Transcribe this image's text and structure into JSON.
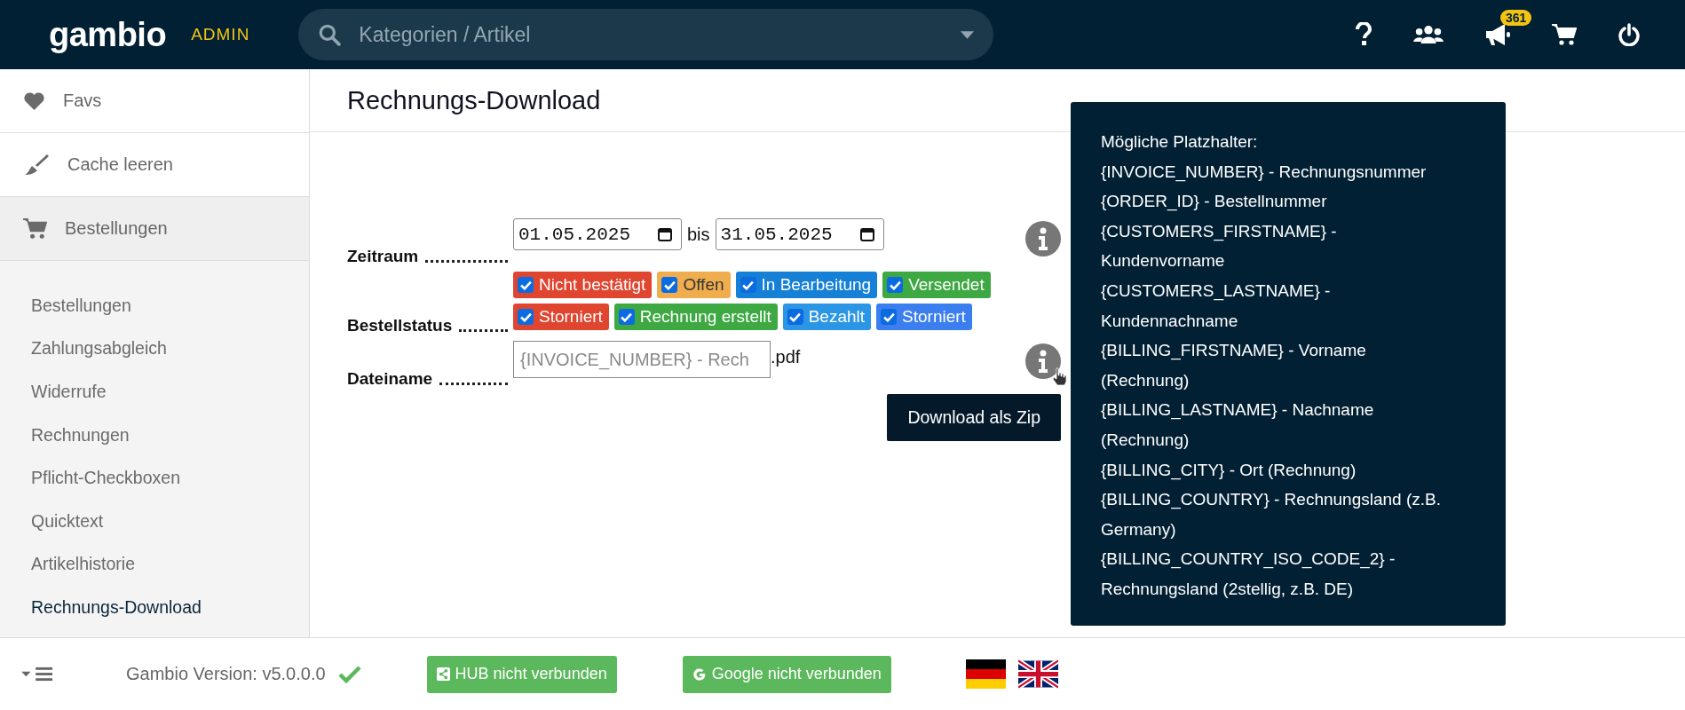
{
  "header": {
    "logo": "gambio",
    "badge": "ADMIN",
    "search": {
      "placeholder": "Kategorien / Artikel"
    },
    "notifications": "361"
  },
  "sidebar": {
    "items": [
      {
        "label": "Favs",
        "selected": false
      },
      {
        "label": "Cache leeren",
        "selected": false
      },
      {
        "label": "Bestellungen",
        "selected": true
      }
    ],
    "submenu": [
      {
        "label": "Bestellungen",
        "selected": false
      },
      {
        "label": "Zahlungsabgleich",
        "selected": false
      },
      {
        "label": "Widerrufe",
        "selected": false
      },
      {
        "label": "Rechnungen",
        "selected": false
      },
      {
        "label": "Pflicht-Checkboxen",
        "selected": false
      },
      {
        "label": "Quicktext",
        "selected": false
      },
      {
        "label": "Artikelhistorie",
        "selected": false
      },
      {
        "label": "Rechnungs-Download",
        "selected": true
      }
    ]
  },
  "page": {
    "title": "Rechnungs-Download",
    "form": {
      "period": {
        "label": "Zeitraum",
        "from": "01.05.2025",
        "separator": "bis",
        "to": "31.05.2025"
      },
      "status": {
        "label": "Bestellstatus",
        "options": [
          {
            "label": "Nicht bestätigt",
            "checked": true,
            "color": "#e0452f"
          },
          {
            "label": "Offen",
            "checked": true,
            "color": "#f0ad4e"
          },
          {
            "label": "In Bearbeitung",
            "checked": true,
            "color": "#1580d6"
          },
          {
            "label": "Versendet",
            "checked": true,
            "color": "#3ea842"
          },
          {
            "label": "Storniert",
            "checked": true,
            "color": "#e0452f"
          },
          {
            "label": "Rechnung erstellt",
            "checked": true,
            "color": "#3ea842"
          },
          {
            "label": "Bezahlt",
            "checked": true,
            "color": "#2b95e6"
          },
          {
            "label": "Storniert",
            "checked": true,
            "color": "#3b7ef0"
          }
        ]
      },
      "filename": {
        "label": "Dateiname",
        "placeholder": "{INVOICE_NUMBER} - Rech",
        "suffix": ".pdf"
      },
      "button": "Download als Zip"
    },
    "tooltip": {
      "title": "Mögliche Platzhalter:",
      "lines": [
        "{INVOICE_NUMBER} - Rechnungsnummer",
        "{ORDER_ID} - Bestellnummer",
        "{CUSTOMERS_FIRSTNAME} - Kundenvorname",
        "{CUSTOMERS_LASTNAME} - Kundennachname",
        "{BILLING_FIRSTNAME} - Vorname (Rechnung)",
        "{BILLING_LASTNAME} - Nachname (Rechnung)",
        "{BILLING_CITY} - Ort (Rechnung)",
        "{BILLING_COUNTRY} - Rechnungsland (z.B. Germany)",
        "{BILLING_COUNTRY_ISO_CODE_2} - Rechnungsland (2stellig, z.B. DE)"
      ]
    }
  },
  "footer": {
    "version": "Gambio Version: v5.0.0.0",
    "buttons": [
      "HUB nicht verbunden",
      "Google nicht verbunden"
    ]
  }
}
